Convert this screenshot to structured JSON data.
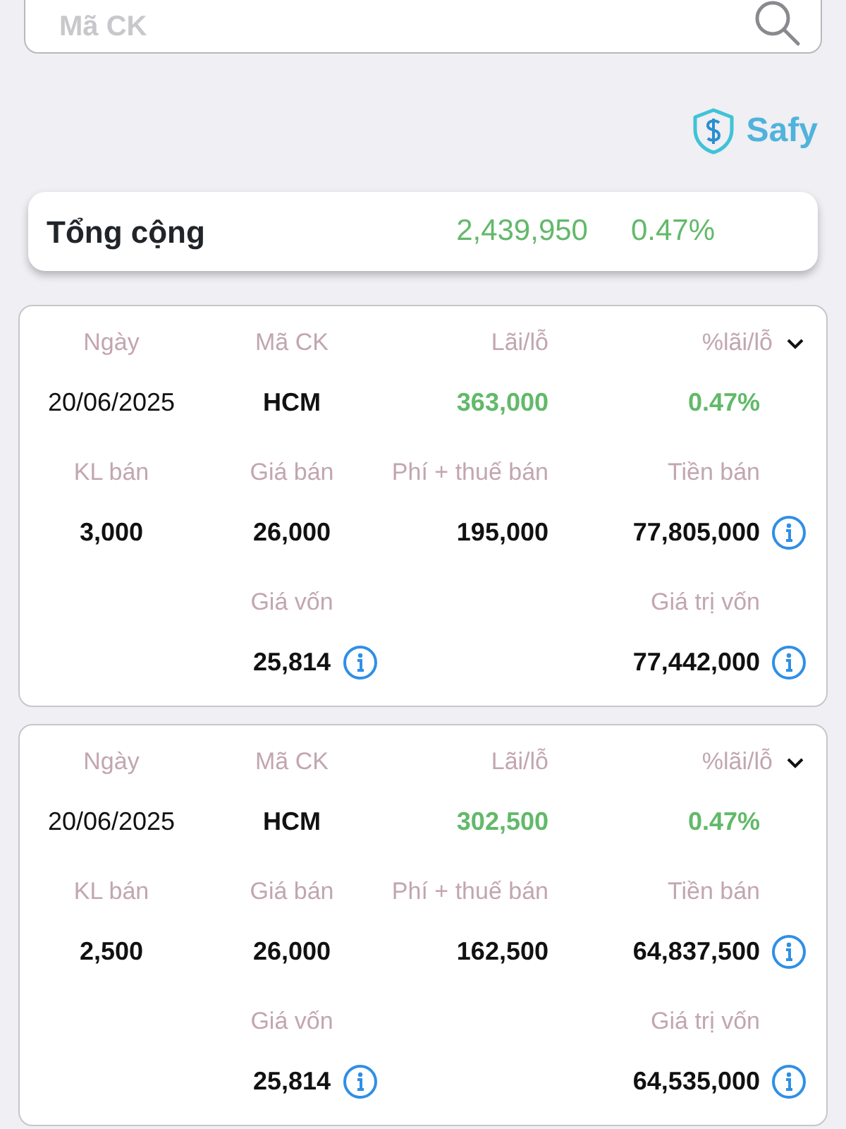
{
  "search": {
    "placeholder": "Mã CK"
  },
  "brand": {
    "name": "Safy"
  },
  "total": {
    "label": "Tổng cộng",
    "value": "2,439,950",
    "percent": "0.47%"
  },
  "trades": [
    {
      "rows": [
        [
          {
            "label": "Ngày",
            "value": "20/06/2025",
            "kind": "plain",
            "info": false
          },
          {
            "label": "Mã CK",
            "value": "HCM",
            "kind": "strong",
            "info": false
          },
          {
            "label": "Lãi/lỗ",
            "value": "363,000",
            "kind": "gain",
            "info": false
          },
          {
            "label": "%lãi/lỗ",
            "value": "0.47%",
            "kind": "gain",
            "info": false
          }
        ],
        [
          {
            "label": "KL bán",
            "value": "3,000",
            "kind": "strong",
            "info": false
          },
          {
            "label": "Giá bán",
            "value": "26,000",
            "kind": "strong",
            "info": false
          },
          {
            "label": "Phí + thuế bán",
            "value": "195,000",
            "kind": "strong",
            "info": false
          },
          {
            "label": "Tiền bán",
            "value": "77,805,000",
            "kind": "strong",
            "info": true
          }
        ],
        [
          {
            "kind": "blank"
          },
          {
            "label": "Giá vốn",
            "value": "25,814",
            "kind": "strong",
            "info": true
          },
          {
            "kind": "blank"
          },
          {
            "label": "Giá trị vốn",
            "value": "77,442,000",
            "kind": "strong",
            "info": true
          }
        ]
      ]
    },
    {
      "rows": [
        [
          {
            "label": "Ngày",
            "value": "20/06/2025",
            "kind": "plain",
            "info": false
          },
          {
            "label": "Mã CK",
            "value": "HCM",
            "kind": "strong",
            "info": false
          },
          {
            "label": "Lãi/lỗ",
            "value": "302,500",
            "kind": "gain",
            "info": false
          },
          {
            "label": "%lãi/lỗ",
            "value": "0.47%",
            "kind": "gain",
            "info": false
          }
        ],
        [
          {
            "label": "KL bán",
            "value": "2,500",
            "kind": "strong",
            "info": false
          },
          {
            "label": "Giá bán",
            "value": "26,000",
            "kind": "strong",
            "info": false
          },
          {
            "label": "Phí + thuế bán",
            "value": "162,500",
            "kind": "strong",
            "info": false
          },
          {
            "label": "Tiền bán",
            "value": "64,837,500",
            "kind": "strong",
            "info": true
          }
        ],
        [
          {
            "kind": "blank"
          },
          {
            "label": "Giá vốn",
            "value": "25,814",
            "kind": "strong",
            "info": true
          },
          {
            "kind": "blank"
          },
          {
            "label": "Giá trị vốn",
            "value": "64,535,000",
            "kind": "strong",
            "info": true
          }
        ]
      ]
    }
  ]
}
